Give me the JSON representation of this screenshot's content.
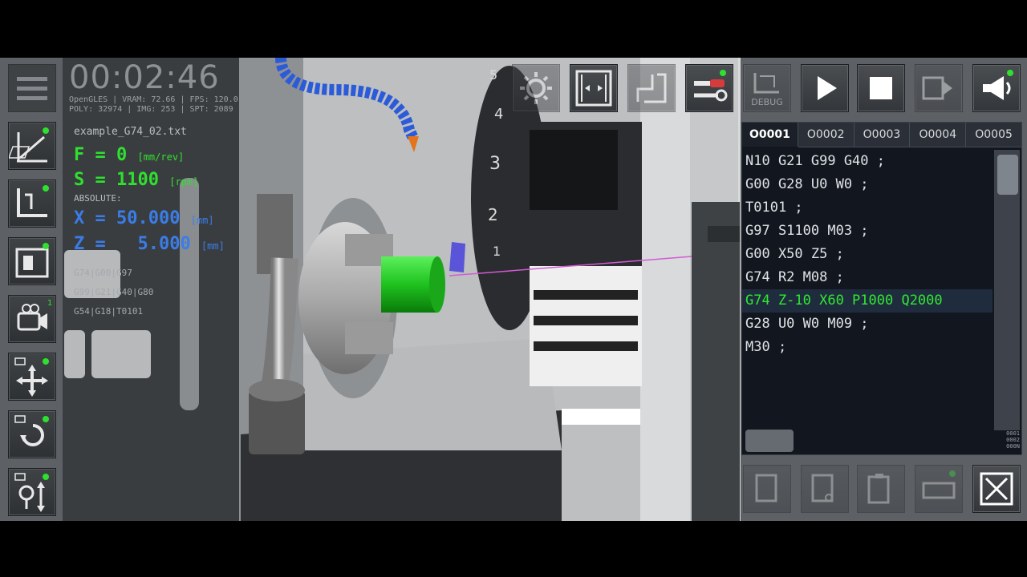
{
  "timer": {
    "elapsed": "00:02:46"
  },
  "stats": {
    "line1": "OpenGLES | VRAM: 72.66 | FPS: 120.0",
    "line2": "POLY: 32974 | IMG: 253 | SPT: 2089"
  },
  "info": {
    "filename": "example_G74_02.txt",
    "feed": "F = 0",
    "feed_unit": "[mm/rev]",
    "speed": "S = 1100",
    "speed_unit": "[rpm]",
    "mode": "ABSOLUTE:",
    "x": "X = 50.000",
    "x_unit": "[mm]",
    "z": "Z =   5.000",
    "z_unit": "[mm]",
    "modal1": "G74|G00|G97",
    "modal2": "G99|G21|G40|G80",
    "modal3": "G54|G18|T0101"
  },
  "spindle_labels": [
    "5",
    "4",
    "3",
    "2",
    "1"
  ],
  "top_toolbar": {
    "debug_label": "DEBUG"
  },
  "program": {
    "tabs": [
      "O0001",
      "O0002",
      "O0003",
      "O0004",
      "O0005"
    ],
    "active_tab": 0,
    "lines": [
      "N10 G21 G99 G40 ;",
      "G00 G28 U0 W0 ;",
      "T0101 ;",
      "G97 S1100 M03 ;",
      "G00 X50 Z5 ;",
      "G74 R2 M08 ;",
      "G74 Z-10 X60 P1000 Q2000",
      "G28 U0 W0 M09 ;",
      "M30 ;"
    ],
    "active_line": 6,
    "counter": "0001\n0002\n000N"
  },
  "colors": {
    "active_green": "#30e830",
    "position_blue": "#3a7de8",
    "workpiece_green": "#1fc21f"
  },
  "icons": {
    "menu": "hamburger-icon",
    "settings": "gear-icon",
    "play": "play-icon",
    "stop": "stop-icon",
    "sound": "megaphone-icon",
    "close": "close-icon"
  }
}
